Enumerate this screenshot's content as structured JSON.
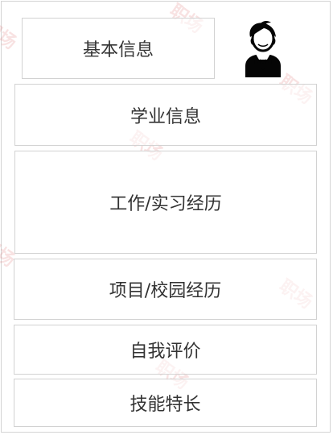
{
  "sections": {
    "basic_info": "基本信息",
    "academic_info": "学业信息",
    "work_internship": "工作/实习经历",
    "project_campus": "项目/校园经历",
    "self_evaluation": "自我评价",
    "skills": "技能特长"
  },
  "watermark": {
    "text": "职场"
  },
  "icons": {
    "avatar": "user-avatar-icon"
  }
}
